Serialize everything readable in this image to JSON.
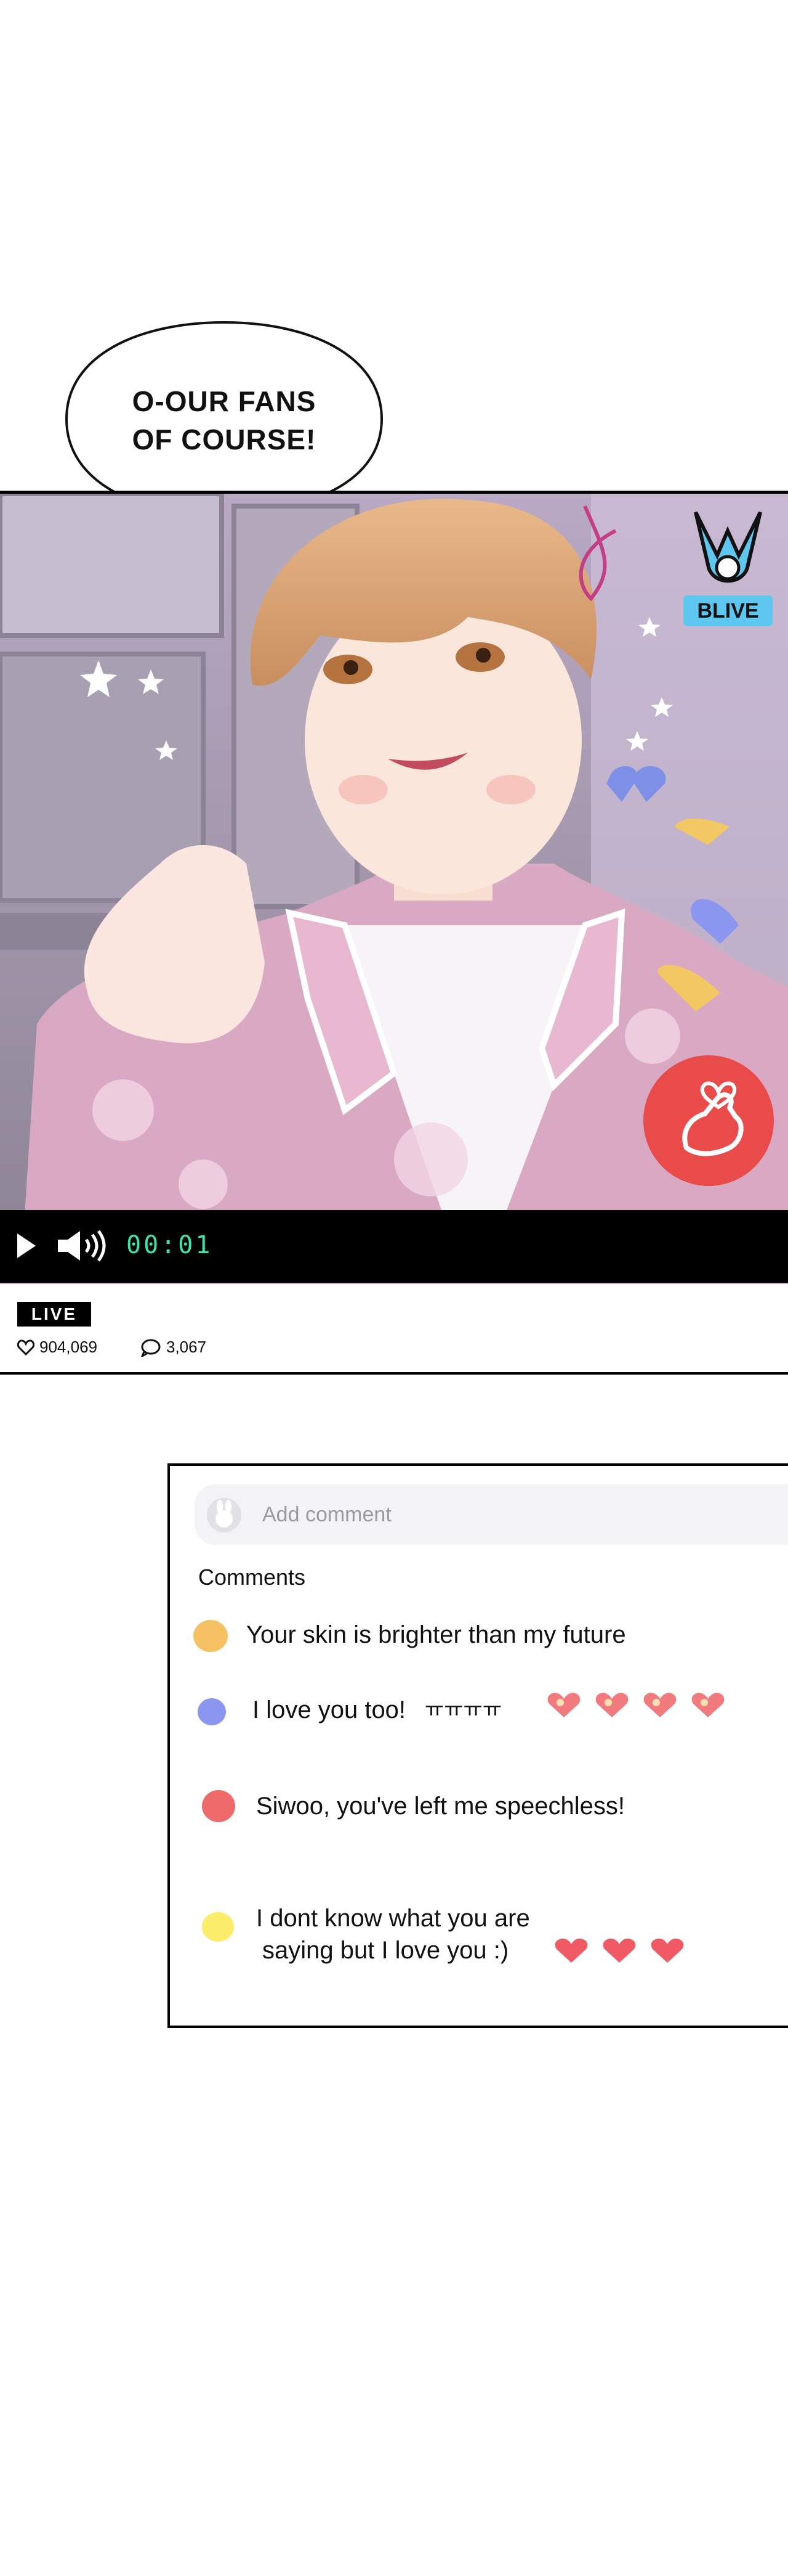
{
  "speech_bubble": {
    "line1": "O-OUR FANS",
    "line2": "OF COURSE!"
  },
  "stream": {
    "logo_label": "BLIVE",
    "time": "00:01",
    "live_badge": "LIVE",
    "likes": "904,069",
    "comment_count": "3,067"
  },
  "comment_panel": {
    "add_placeholder": "Add comment",
    "heading": "Comments",
    "comments": [
      {
        "text": "Your skin is brighter than my future",
        "dot_color": "#f5c163"
      },
      {
        "text": "I love you too!",
        "suffix": "ㅠㅠㅠㅠ",
        "dot_color": "#8a96f0"
      },
      {
        "text": "Siwoo, you've left me speechless!",
        "dot_color": "#ef6a6a"
      },
      {
        "line1": "I dont know what you are",
        "line2": "saying but I love you :)",
        "dot_color": "#fbec6a"
      }
    ]
  },
  "colors": {
    "heart_button": "#e94b4b",
    "time_green": "#3ce6a9",
    "blive_blue": "#5ec7f0"
  },
  "icons": [
    "play-icon",
    "volume-icon",
    "heart-outline-icon",
    "comment-icon",
    "finger-heart-icon",
    "blive-v-logo-icon"
  ]
}
